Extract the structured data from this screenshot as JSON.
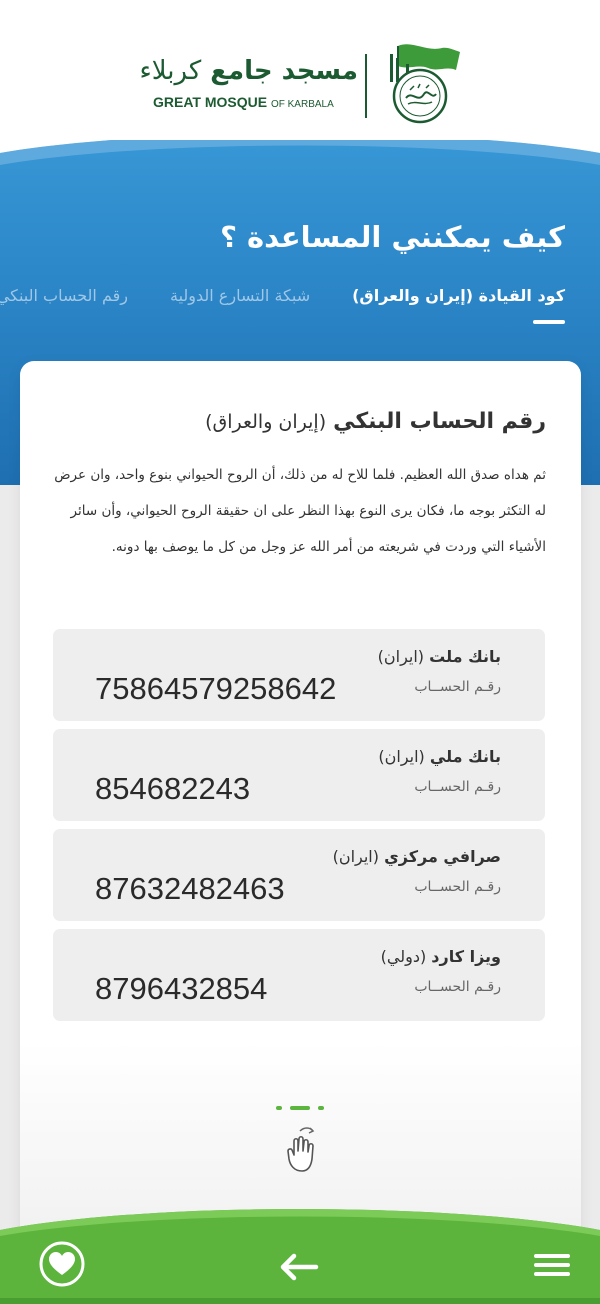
{
  "header": {
    "logo_ar_bold": "مسجد جامع",
    "logo_ar_light": "كربلاء",
    "logo_en_bold": "GREAT MOSQUE",
    "logo_en_small": "OF KARBALA",
    "emblem_text": "Imam Hussein(AS) Grand Mosque Karbala"
  },
  "hero": {
    "title": "كيف يمكنني المساعدة ؟",
    "tabs": [
      {
        "label": "كود القيادة (إيران والعراق)",
        "active": true
      },
      {
        "label": "شبكة التسارع الدولية",
        "active": false
      },
      {
        "label": "رقم الحساب البنكي",
        "active": false
      }
    ]
  },
  "card": {
    "title_bold": "رقم الحساب البنكي",
    "title_paren": "(إيران والعراق)",
    "text": "ثم هداه صدق الله العظيم. فلما للاح له من ذلك، أن الروح الحيواني بنوع واحد، وان عرض له التكثر بوجه ما، فكان يرى النوع بهذا النظر على ان حقيقة الروح الحيواني، وأن سائر الأشياء التي وردت في شريعته من أمر الله عز وجل من كل ما يوصف بها دونه.",
    "accounts": [
      {
        "bank": "بانك ملت",
        "country": "(ایران)",
        "label": "رقـم الحســاب",
        "number": "75864579258642"
      },
      {
        "bank": "بانك ملي",
        "country": "(ایران)",
        "label": "رقـم الحســاب",
        "number": "854682243"
      },
      {
        "bank": "صرافي مركزي",
        "country": "(ایران)",
        "label": "رقـم الحســاب",
        "number": "87632482463"
      },
      {
        "bank": "ويزا كارد",
        "country": "(دولي)",
        "label": "رقـم الحســاب",
        "number": "8796432854"
      }
    ]
  },
  "colors": {
    "brand_green": "#1c5b32",
    "hero_blue": "#2c87c8",
    "accent_green": "#5bb53f"
  },
  "icons": {
    "favorite": "heart-icon",
    "back": "arrow-left-icon",
    "menu": "hamburger-icon",
    "swipe": "swipe-hand-icon"
  }
}
